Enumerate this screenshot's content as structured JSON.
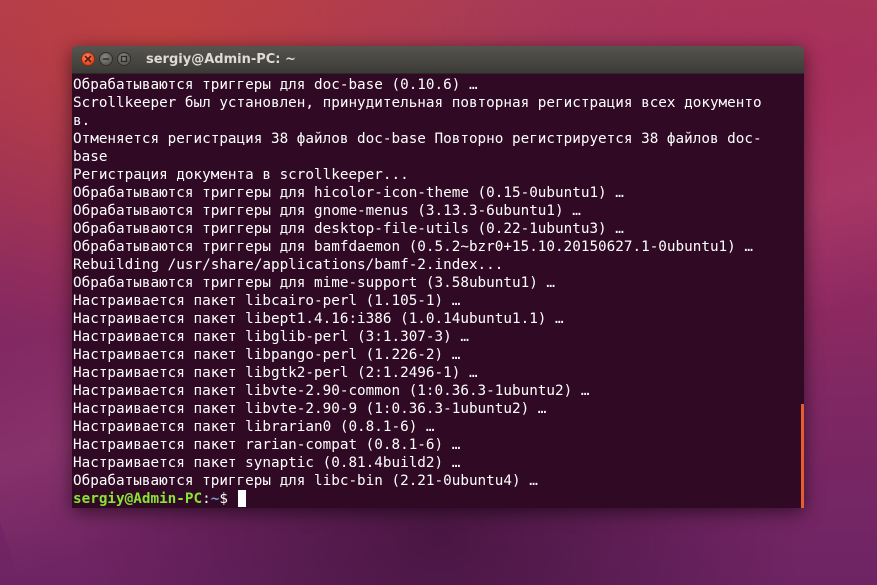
{
  "window": {
    "title": "sergiy@Admin-PC: ~"
  },
  "icons": {
    "close": "close-icon",
    "minimize": "minimize-icon",
    "maximize": "maximize-icon"
  },
  "colors": {
    "terminal_bg": "#300a24",
    "prompt_user": "#8ae234",
    "prompt_path": "#729fcf",
    "close_button": "#e5512a",
    "scrollbar": "#e85d2f"
  },
  "terminal": {
    "lines": [
      "Обрабатываются триггеры для doc-base (0.10.6) …",
      "Scrollkeeper был установлен, принудительная повторная регистрация всех документо",
      "в.",
      "Отменяется регистрация 38 файлов doc-base Повторно регистрируется 38 файлов doc-",
      "base",
      "Регистрация документа в scrollkeeper...",
      "Обрабатываются триггеры для hicolor-icon-theme (0.15-0ubuntu1) …",
      "Обрабатываются триггеры для gnome-menus (3.13.3-6ubuntu1) …",
      "Обрабатываются триггеры для desktop-file-utils (0.22-1ubuntu3) …",
      "Обрабатываются триггеры для bamfdaemon (0.5.2~bzr0+15.10.20150627.1-0ubuntu1) …",
      "Rebuilding /usr/share/applications/bamf-2.index...",
      "Обрабатываются триггеры для mime-support (3.58ubuntu1) …",
      "Настраивается пакет libcairo-perl (1.105-1) …",
      "Настраивается пакет libept1.4.16:i386 (1.0.14ubuntu1.1) …",
      "Настраивается пакет libglib-perl (3:1.307-3) …",
      "Настраивается пакет libpango-perl (1.226-2) …",
      "Настраивается пакет libgtk2-perl (2:1.2496-1) …",
      "Настраивается пакет libvte-2.90-common (1:0.36.3-1ubuntu2) …",
      "Настраивается пакет libvte-2.90-9 (1:0.36.3-1ubuntu2) …",
      "Настраивается пакет librarian0 (0.8.1-6) …",
      "Настраивается пакет rarian-compat (0.8.1-6) …",
      "Настраивается пакет synaptic (0.81.4build2) …",
      "Обрабатываются триггеры для libc-bin (2.21-0ubuntu4) …"
    ],
    "prompt": {
      "user_host": "sergiy@Admin-PC",
      "separator": ":",
      "path": "~",
      "symbol": "$ "
    }
  }
}
